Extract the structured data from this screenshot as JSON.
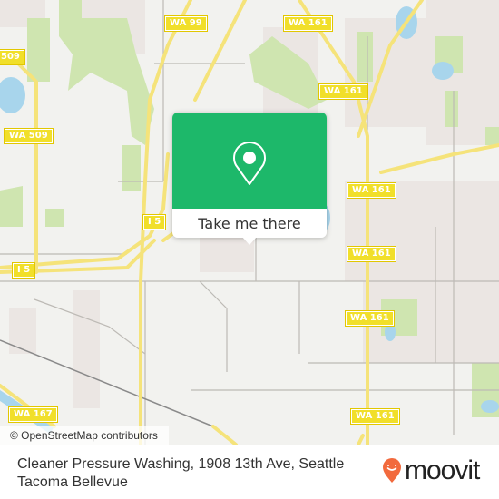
{
  "map": {
    "attribution": "© OpenStreetMap contributors",
    "colors": {
      "land": "#f2f2ef",
      "urban": "#ebe6e3",
      "park": "#cfe5b0",
      "water": "#a8d5ec",
      "highway": "#f5e37a",
      "road": "#bdbab5",
      "shield": "#f1df2a"
    },
    "road_labels": [
      {
        "name": "wa99-shield",
        "text": "WA 99"
      },
      {
        "name": "wa161-shield-1",
        "text": "WA 161"
      },
      {
        "name": "wa161-shield-2",
        "text": "WA 161"
      },
      {
        "name": "wa509-shield-1",
        "text": "509"
      },
      {
        "name": "wa509-shield-2",
        "text": "WA 509"
      },
      {
        "name": "wa161-shield-3",
        "text": "WA 161"
      },
      {
        "name": "i5-shield-1",
        "text": "I 5"
      },
      {
        "name": "i5-shield-2",
        "text": "I 5"
      },
      {
        "name": "wa161-shield-4",
        "text": "WA 161"
      },
      {
        "name": "wa161-shield-5",
        "text": "WA 161"
      },
      {
        "name": "wa167-shield",
        "text": "WA 167"
      },
      {
        "name": "wa161-shield-6",
        "text": "WA 161"
      }
    ]
  },
  "popup": {
    "icon": "map-pin-icon",
    "action_label": "Take me there",
    "color": "#1db86a"
  },
  "footer": {
    "address": "Cleaner Pressure Washing, 1908 13th Ave, Seattle Tacoma Bellevue",
    "brand": "moovit",
    "brand_color": "#f26a3d"
  }
}
